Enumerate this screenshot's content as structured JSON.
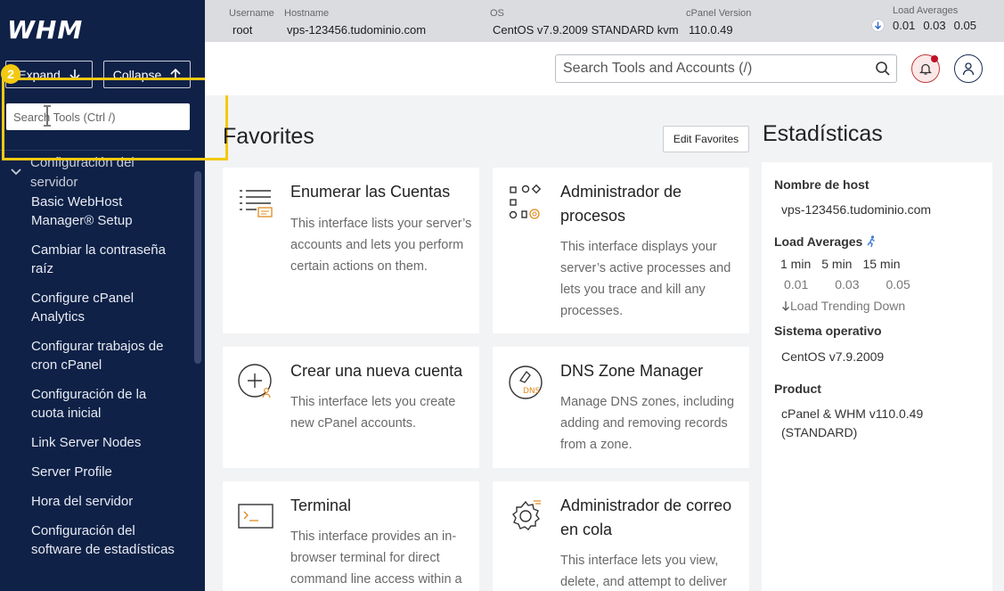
{
  "sidebar": {
    "logo": "WHM",
    "expand_label": "Expand",
    "collapse_label": "Collapse",
    "search_placeholder": "Search Tools (Ctrl /)",
    "group_title": "Configuración del servidor",
    "items": [
      "Basic WebHost Manager® Setup",
      "Cambiar la contraseña raíz",
      "Configure cPanel Analytics",
      "Configurar trabajos de cron cPanel",
      "Configuración de la cuota inicial",
      "Link Server Nodes",
      "Server Profile",
      "Hora del servidor",
      "Configuración del software de estadísticas"
    ]
  },
  "tutorial": {
    "step": "2"
  },
  "topbar": {
    "username_label": "Username",
    "username": "root",
    "hostname_label": "Hostname",
    "hostname": "vps-123456.tudominio.com",
    "os_label": "OS",
    "os": "CentOS v7.9.2009 STANDARD kvm",
    "cpanel_label": "cPanel Version",
    "cpanel": "110.0.49",
    "load_label": "Load Averages",
    "load": [
      "0.01",
      "0.03",
      "0.05"
    ]
  },
  "header": {
    "search_placeholder": "Search Tools and Accounts (/)"
  },
  "favorites": {
    "title": "Favorites",
    "edit_label": "Edit Favorites",
    "cards": [
      {
        "title": "Enumerar las Cuentas",
        "desc": "This interface lists your server’s accounts and lets you perform certain actions on them."
      },
      {
        "title": "Administrador de procesos",
        "desc": "This interface displays your server’s active processes and lets you trace and kill any processes."
      },
      {
        "title": "Crear una nueva cuenta",
        "desc": "This interface lets you create new cPanel accounts."
      },
      {
        "title": "DNS Zone Manager",
        "desc": "Manage DNS zones, including adding and removing records from a zone."
      },
      {
        "title": "Terminal",
        "desc": "This interface provides an in-browser terminal for direct command line access within a"
      },
      {
        "title": "Administrador de correo en cola",
        "desc": "This interface lets you view, delete, and attempt to deliver"
      }
    ]
  },
  "stats": {
    "title": "Estadísticas",
    "host_label": "Nombre de host",
    "host": "vps-123456.tudominio.com",
    "load_label": "Load Averages",
    "load_cols": [
      "1 min",
      "5 min",
      "15 min"
    ],
    "load_vals": [
      "0.01",
      "0.03",
      "0.05"
    ],
    "trend": "Load Trending Down",
    "os_label": "Sistema operativo",
    "os": "CentOS v7.9.2009",
    "product_label": "Product",
    "product": "cPanel & WHM v110.0.49 (STANDARD)"
  },
  "colors": {
    "sidebar": "#0f2147",
    "highlight": "#f3c911",
    "notification": "#c0102a"
  }
}
